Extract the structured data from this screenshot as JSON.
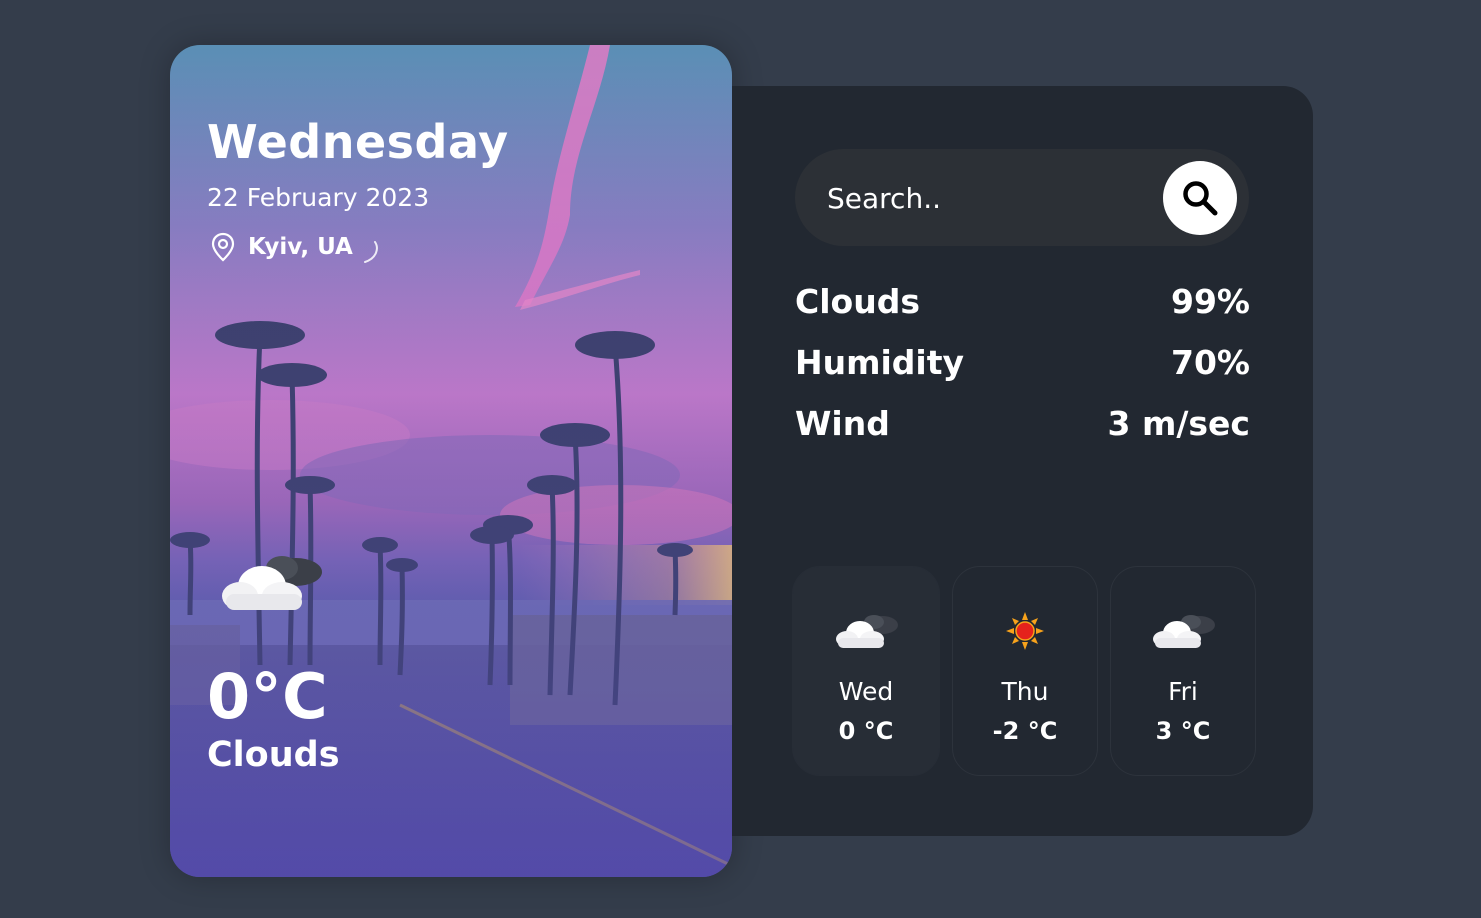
{
  "current": {
    "day": "Wednesday",
    "date": "22 February 2023",
    "location": "Kyiv, UA",
    "temperature": "0°C",
    "condition": "Clouds",
    "icon": "cloud-icon"
  },
  "search": {
    "placeholder": "Search..",
    "button_icon": "search-icon"
  },
  "stats": [
    {
      "label": "Clouds",
      "value": "99%"
    },
    {
      "label": "Humidity",
      "value": "70%"
    },
    {
      "label": "Wind",
      "value": "3 m/sec"
    }
  ],
  "forecast": [
    {
      "day": "Wed",
      "temp": "0 °C",
      "icon": "cloud-icon"
    },
    {
      "day": "Thu",
      "temp": "-2 °C",
      "icon": "sun-icon"
    },
    {
      "day": "Fri",
      "temp": "3 °C",
      "icon": "cloud-icon"
    }
  ],
  "colors": {
    "page_background": "#343d4b",
    "panel_background": "#222831",
    "search_background": "#2c3036",
    "text": "#ffffff"
  }
}
